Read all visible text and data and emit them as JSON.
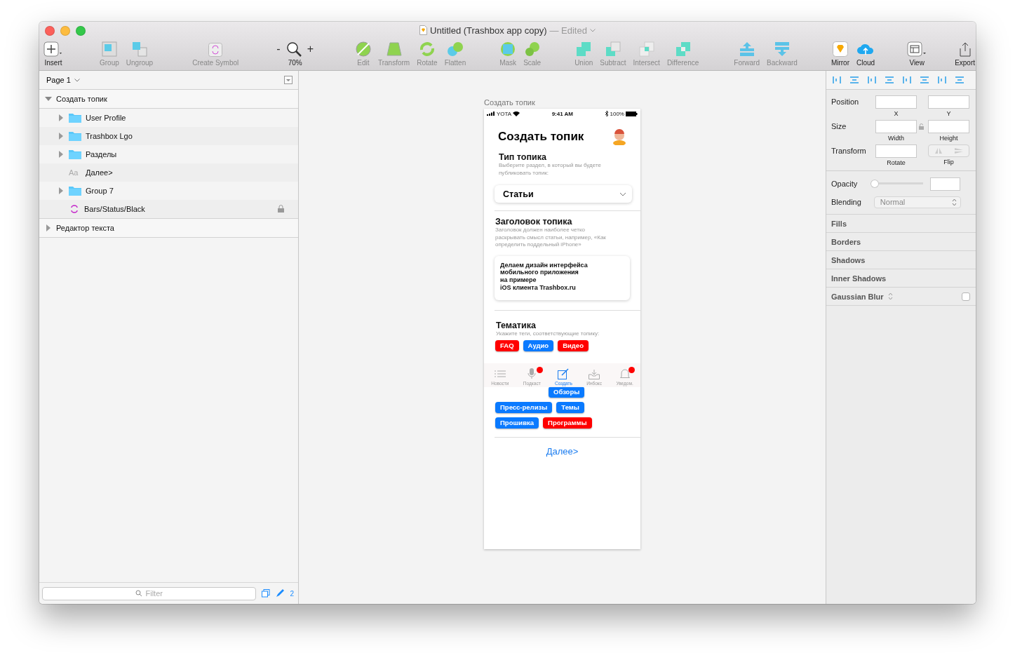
{
  "window": {
    "title": "Untitled (Trashbox app copy)",
    "edited": "— Edited"
  },
  "toolbar": [
    {
      "label": "Insert",
      "kind": "menu"
    },
    {
      "label": "Group",
      "kind": "tool"
    },
    {
      "label": "Ungroup",
      "kind": "tool"
    },
    {
      "label": "Create Symbol",
      "kind": "tool"
    },
    {
      "label": "70%",
      "kind": "zoom",
      "minus": "-",
      "plus": "+"
    },
    {
      "label": "Edit",
      "kind": "tool"
    },
    {
      "label": "Transform",
      "kind": "tool"
    },
    {
      "label": "Rotate",
      "kind": "tool"
    },
    {
      "label": "Flatten",
      "kind": "tool"
    },
    {
      "label": "Mask",
      "kind": "tool"
    },
    {
      "label": "Scale",
      "kind": "tool"
    },
    {
      "label": "Union",
      "kind": "tool"
    },
    {
      "label": "Subtract",
      "kind": "tool"
    },
    {
      "label": "Intersect",
      "kind": "tool"
    },
    {
      "label": "Difference",
      "kind": "tool"
    },
    {
      "label": "Forward",
      "kind": "tool"
    },
    {
      "label": "Backward",
      "kind": "tool"
    },
    {
      "label": "Mirror",
      "kind": "tool"
    },
    {
      "label": "Cloud",
      "kind": "tool"
    },
    {
      "label": "View",
      "kind": "menu"
    },
    {
      "label": "Export",
      "kind": "tool"
    }
  ],
  "sidebar": {
    "page": "Page 1",
    "layers": [
      {
        "name": "Создать топик",
        "kind": "artboard",
        "expanded": true,
        "children": [
          {
            "name": "User Profile",
            "kind": "group",
            "expanded": false,
            "locked": false
          },
          {
            "name": "Trashbox Lgo",
            "kind": "group",
            "expanded": false,
            "locked": false
          },
          {
            "name": "Разделы",
            "kind": "group",
            "expanded": false,
            "locked": false
          },
          {
            "name": "Далее>",
            "kind": "text",
            "locked": false,
            "icon_text": "Aa"
          },
          {
            "name": "Group 7",
            "kind": "group",
            "expanded": false,
            "locked": false
          },
          {
            "name": "Bars/Status/Black",
            "kind": "symbol",
            "locked": true
          }
        ]
      },
      {
        "name": "Редактор текста",
        "kind": "artboard",
        "expanded": false
      }
    ],
    "filter": {
      "placeholder": "Filter"
    },
    "count": "2"
  },
  "artboard": {
    "label": "Создать топик",
    "status_bar": {
      "carrier": "YOTA",
      "time": "9:41 AM",
      "battery": "100%"
    },
    "title": "Создать топик",
    "type_section": {
      "heading": "Тип топика",
      "hint": "Выберите раздел, в который вы будете публиковать топик:",
      "value": "Статьи"
    },
    "title_section": {
      "heading": "Заголовок топика",
      "hint": "Заголовок должен наиболее четко раскрывать смысл статьи, например, «Как определить поддельный iPhone»",
      "lines": [
        "Делаем дизайн интерфейса",
        "мобильного приложения",
        "на примере",
        "iOS клиента Trashbox.ru"
      ]
    },
    "tags_section": {
      "heading": "Тематика",
      "hint": "Укажите теги, соответствующие топику:",
      "tags": [
        {
          "label": "FAQ",
          "color": "#ff0000"
        },
        {
          "label": "Аудио",
          "color": "#0a7aff"
        },
        {
          "label": "Видео",
          "color": "#ff0000"
        },
        {
          "label": "Обзоры",
          "color": "#0a7aff"
        },
        {
          "label": "Пресс-релизы",
          "color": "#0a7aff"
        },
        {
          "label": "Темы",
          "color": "#0a7aff"
        },
        {
          "label": "Прошивка",
          "color": "#0a7aff"
        },
        {
          "label": "Программы",
          "color": "#ff0000"
        }
      ]
    },
    "next_link": "Далее>",
    "tab_bar": [
      {
        "label": "Новости",
        "selected": false,
        "badge": false
      },
      {
        "label": "Подкаст",
        "selected": false,
        "badge": true
      },
      {
        "label": "Создать",
        "selected": true,
        "badge": false
      },
      {
        "label": "Инбокс",
        "selected": false,
        "badge": false
      },
      {
        "label": "Уведом.",
        "selected": false,
        "badge": true
      }
    ]
  },
  "inspector": {
    "position": {
      "label": "Position",
      "x": "X",
      "y": "Y"
    },
    "size": {
      "label": "Size",
      "w": "Width",
      "h": "Height"
    },
    "transform": {
      "label": "Transform",
      "rotate": "Rotate",
      "flip": "Flip"
    },
    "opacity": {
      "label": "Opacity",
      "level": 0
    },
    "blending": {
      "label": "Blending",
      "value": "Normal"
    },
    "sections": [
      {
        "label": "Fills"
      },
      {
        "label": "Borders"
      },
      {
        "label": "Shadows"
      },
      {
        "label": "Inner Shadows"
      },
      {
        "label": "Gaussian Blur",
        "kind": "toggle",
        "checked": false
      }
    ]
  }
}
